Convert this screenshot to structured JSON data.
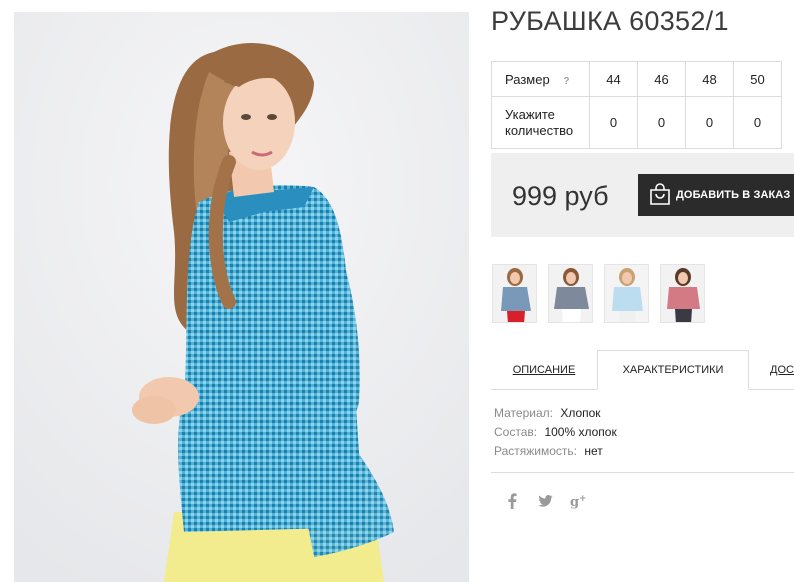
{
  "product": {
    "title": "РУБАШКА 60352/1"
  },
  "size_table": {
    "size_label": "Размер",
    "help_icon": "?",
    "quantity_label_line1": "Укажите",
    "quantity_label_line2": "количество",
    "sizes": [
      "44",
      "46",
      "48",
      "50"
    ],
    "quantities": [
      "0",
      "0",
      "0",
      "0"
    ]
  },
  "price_box": {
    "price": "999 руб",
    "add_to_cart_label": "ДОБАВИТЬ В ЗАКАЗ",
    "icon": "shopping-bag-icon"
  },
  "thumbnails": [
    {
      "name": "blue-check-shirt-thumb",
      "shirt_color": "#7a98b8",
      "pants_color": "#d8202a"
    },
    {
      "name": "gray-check-shirt-thumb",
      "shirt_color": "#7e8a9c",
      "pants_color": "#ffffff"
    },
    {
      "name": "light-blue-shirt-thumb",
      "shirt_color": "#bcdcf0",
      "pants_color": "#f0f0f0"
    },
    {
      "name": "red-check-shirt-thumb",
      "shirt_color": "#d47a84",
      "pants_color": "#3a3a44"
    }
  ],
  "tabs": [
    {
      "label": "ОПИСАНИЕ",
      "active": false
    },
    {
      "label": "ХАРАКТЕРИСТИКИ",
      "active": true
    },
    {
      "label": "ДОСТАВКА",
      "active": false
    }
  ],
  "specs": [
    {
      "key": "Материал:",
      "value": "Хлопок"
    },
    {
      "key": "Состав:",
      "value": "100% хлопок"
    },
    {
      "key": "Растяжимость:",
      "value": "нет"
    }
  ],
  "social": [
    {
      "icon": "facebook-icon",
      "glyph": "f"
    },
    {
      "icon": "twitter-icon",
      "glyph": "🐦"
    },
    {
      "icon": "google-plus-icon",
      "glyph": "g+"
    }
  ],
  "colors": {
    "button_bg": "#2b2b2b",
    "price_box_bg": "#efefef",
    "shirt": "#3fb0d8",
    "pants": "#f3ec8e"
  }
}
